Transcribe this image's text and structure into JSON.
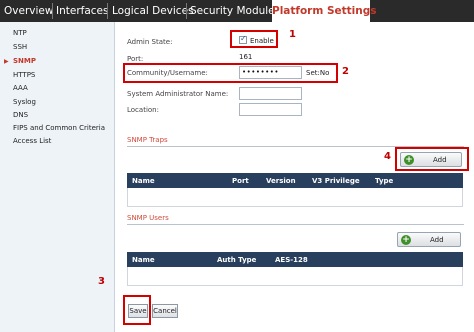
{
  "tabs": [
    {
      "label": "Overview",
      "active": false
    },
    {
      "label": "Interfaces",
      "active": false
    },
    {
      "label": "Logical Devices",
      "active": false
    },
    {
      "label": "Security Modules",
      "active": false
    },
    {
      "label": "Platform Settings",
      "active": true
    }
  ],
  "sidebar": {
    "items": [
      {
        "label": "NTP",
        "active": false
      },
      {
        "label": "SSH",
        "active": false
      },
      {
        "label": "SNMP",
        "active": true
      },
      {
        "label": "HTTPS",
        "active": false
      },
      {
        "label": "AAA",
        "active": false
      },
      {
        "label": "Syslog",
        "active": false
      },
      {
        "label": "DNS",
        "active": false
      },
      {
        "label": "FIPS and Common Criteria",
        "active": false
      },
      {
        "label": "Access List",
        "active": false
      }
    ]
  },
  "form": {
    "admin_state_label": "Admin State:",
    "enable_label": "Enable",
    "enable_checked": true,
    "port_label": "Port:",
    "port_value": "161",
    "community_label": "Community/Username:",
    "community_value": "••••••••",
    "set_status": "Set:No",
    "sysadmin_label": "System Administrator Name:",
    "sysadmin_value": "",
    "location_label": "Location:",
    "location_value": ""
  },
  "traps": {
    "title": "SNMP Traps",
    "add_label": "Add",
    "columns": [
      "Name",
      "Port",
      "Version",
      "V3 Privilege",
      "Type"
    ]
  },
  "users": {
    "title": "SNMP Users",
    "add_label": "Add",
    "columns": [
      "Name",
      "Auth Type",
      "AES-128"
    ]
  },
  "footer": {
    "save_label": "Save",
    "cancel_label": "Cancel"
  },
  "annotations": [
    "1",
    "2",
    "3",
    "4"
  ],
  "colors": {
    "tabbar_bg": "#2a2a2a",
    "active_tab_text": "#c0392b",
    "table_header_bg": "#283f5d",
    "annotation_red": "#d40000",
    "section_title": "#d14b3b",
    "add_icon_green": "#3f8f2a"
  }
}
